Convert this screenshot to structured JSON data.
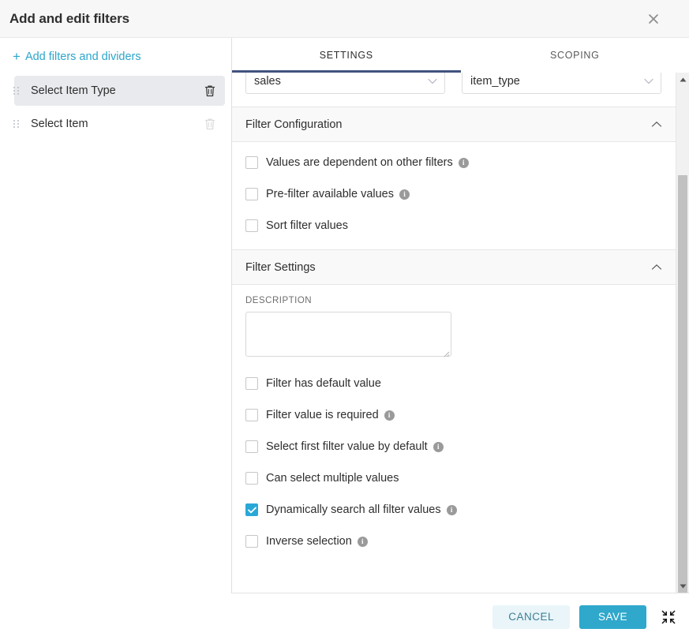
{
  "header": {
    "title": "Add and edit filters",
    "close_icon": "close-icon"
  },
  "sidebar": {
    "add_link": "Add filters and dividers",
    "plus_icon": "plus-icon",
    "items": [
      {
        "label": "Select Item Type",
        "active": true,
        "delete_icon": "trash-icon",
        "drag_icon": "drag-handle-icon"
      },
      {
        "label": "Select Item",
        "active": false,
        "delete_icon": "trash-icon",
        "drag_icon": "drag-handle-icon"
      }
    ]
  },
  "tabs": [
    {
      "label": "SETTINGS",
      "active": true
    },
    {
      "label": "SCOPING",
      "active": false
    }
  ],
  "selectors": [
    {
      "value": "sales",
      "caret_icon": "chevron-down-icon"
    },
    {
      "value": "item_type",
      "caret_icon": "chevron-down-icon"
    }
  ],
  "sections": [
    {
      "title": "Filter Configuration",
      "collapse_icon": "chevron-up-icon",
      "checkboxes": [
        {
          "label": "Values are dependent on other filters",
          "checked": false,
          "info": true
        },
        {
          "label": "Pre-filter available values",
          "checked": false,
          "info": true
        },
        {
          "label": "Sort filter values",
          "checked": false,
          "info": false
        }
      ]
    },
    {
      "title": "Filter Settings",
      "collapse_icon": "chevron-up-icon",
      "description_label": "DESCRIPTION",
      "description_value": "",
      "description_placeholder": "",
      "checkboxes": [
        {
          "label": "Filter has default value",
          "checked": false,
          "info": false
        },
        {
          "label": "Filter value is required",
          "checked": false,
          "info": true
        },
        {
          "label": "Select first filter value by default",
          "checked": false,
          "info": true
        },
        {
          "label": "Can select multiple values",
          "checked": false,
          "info": false
        },
        {
          "label": "Dynamically search all filter values",
          "checked": true,
          "info": true
        },
        {
          "label": "Inverse selection",
          "checked": false,
          "info": true
        }
      ]
    }
  ],
  "scrollbar": {
    "up_icon": "scroll-up-arrow-icon",
    "down_icon": "scroll-down-arrow-icon"
  },
  "footer": {
    "cancel_label": "CANCEL",
    "save_label": "SAVE",
    "expand_icon": "collapse-arrows-icon"
  },
  "colors": {
    "accent": "#2fa8cc",
    "link": "#2ba6cb",
    "checkbox_checked": "#29a8d8",
    "tab_underline": "#41527e",
    "cancel_bg": "#e9f5f9"
  }
}
